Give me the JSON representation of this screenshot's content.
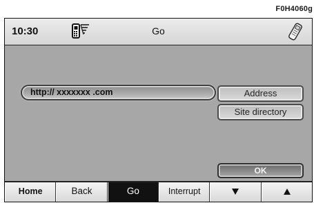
{
  "figure_code": "F0H4060g",
  "status_bar": {
    "time": "10:30",
    "title": "Go",
    "phone_icon": "phone-signal-icon",
    "handset_icon": "handset-icon"
  },
  "url_field": {
    "value": "http:// xxxxxxx .com"
  },
  "side_buttons": {
    "address_label": "Address",
    "site_directory_label": "Site directory",
    "ok_label": "OK"
  },
  "bottom_bar": {
    "home": "Home",
    "back": "Back",
    "go": "Go",
    "interrupt": "Interrupt",
    "down_icon": "arrow-down-icon",
    "up_icon": "arrow-up-icon",
    "active_key": "go"
  }
}
